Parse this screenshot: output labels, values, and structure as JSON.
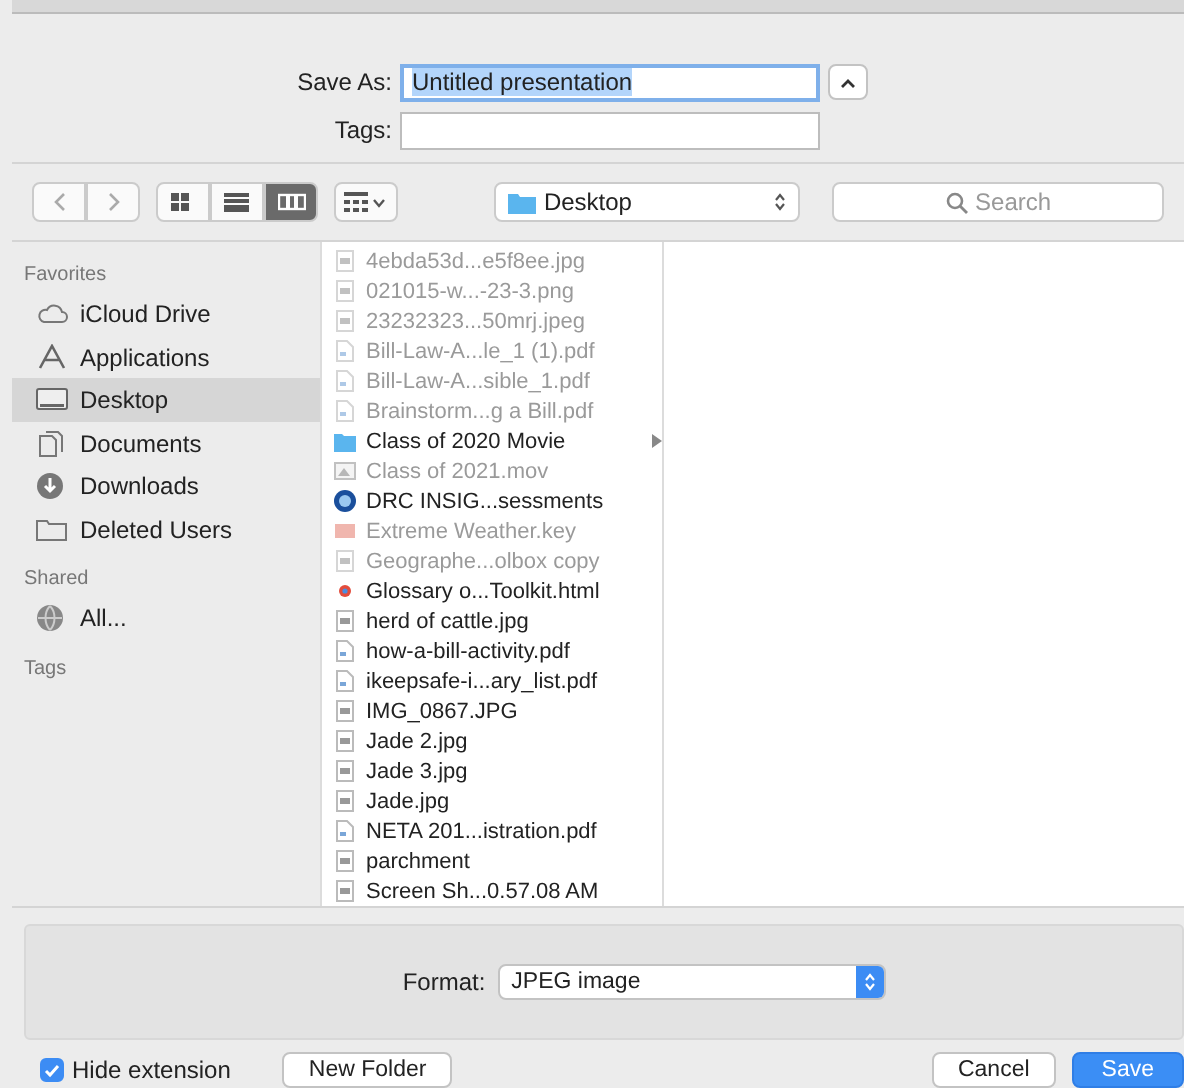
{
  "save_as": {
    "label": "Save As:",
    "value": "Untitled presentation",
    "text_selected": true
  },
  "tags": {
    "label": "Tags:"
  },
  "toolbar": {
    "views": [
      {
        "kind": "icons",
        "selected": false
      },
      {
        "kind": "list",
        "selected": false
      },
      {
        "kind": "columns",
        "selected": true
      }
    ],
    "location": "Desktop",
    "search": {
      "placeholder": "Search"
    }
  },
  "sidebar": [
    {
      "heading": "Favorites",
      "items": [
        {
          "label": "iCloud Drive",
          "kind": "cloud",
          "selected": false
        },
        {
          "label": "Applications",
          "kind": "apps",
          "selected": false
        },
        {
          "label": "Desktop",
          "kind": "desktop",
          "selected": true
        },
        {
          "label": "Documents",
          "kind": "documents",
          "selected": false
        },
        {
          "label": "Downloads",
          "kind": "downloads",
          "selected": false
        },
        {
          "label": "Deleted Users",
          "kind": "folder",
          "selected": false
        }
      ]
    },
    {
      "heading": "Shared",
      "items": [
        {
          "label": "All...",
          "kind": "network",
          "selected": false
        }
      ]
    },
    {
      "heading": "Tags"
    }
  ],
  "files": [
    {
      "name": "4ebda53d...e5f8ee.jpg",
      "kind": "image",
      "disabled": true
    },
    {
      "name": "021015-w...-23-3.png",
      "kind": "image",
      "disabled": true
    },
    {
      "name": "23232323...50mrj.jpeg",
      "kind": "image",
      "disabled": true
    },
    {
      "name": "Bill-Law-A...le_1 (1).pdf",
      "kind": "pdf",
      "disabled": true
    },
    {
      "name": "Bill-Law-A...sible_1.pdf",
      "kind": "pdf",
      "disabled": true
    },
    {
      "name": "Brainstorm...g a Bill.pdf",
      "kind": "pdf",
      "disabled": true
    },
    {
      "name": "Class of 2020 Movie",
      "kind": "folder",
      "disabled": false
    },
    {
      "name": "Class of 2021.mov",
      "kind": "movie",
      "disabled": true
    },
    {
      "name": "DRC INSIG...sessments",
      "kind": "app",
      "disabled": false
    },
    {
      "name": "Extreme Weather.key",
      "kind": "keynote",
      "disabled": true
    },
    {
      "name": "Geographe...olbox copy",
      "kind": "image",
      "disabled": true
    },
    {
      "name": "Glossary o...Toolkit.html",
      "kind": "html",
      "disabled": false
    },
    {
      "name": "herd of cattle.jpg",
      "kind": "image",
      "disabled": false
    },
    {
      "name": "how-a-bill-activity.pdf",
      "kind": "pdf",
      "disabled": false
    },
    {
      "name": "ikeepsafe-i...ary_list.pdf",
      "kind": "pdf",
      "disabled": false
    },
    {
      "name": "IMG_0867.JPG",
      "kind": "image",
      "disabled": false
    },
    {
      "name": "Jade 2.jpg",
      "kind": "image",
      "disabled": false
    },
    {
      "name": "Jade 3.jpg",
      "kind": "image",
      "disabled": false
    },
    {
      "name": "Jade.jpg",
      "kind": "image",
      "disabled": false
    },
    {
      "name": "NETA 201...istration.pdf",
      "kind": "pdf",
      "disabled": false
    },
    {
      "name": "parchment",
      "kind": "image",
      "disabled": false
    },
    {
      "name": "Screen Sh...0.57.08 AM",
      "kind": "image",
      "disabled": false
    }
  ],
  "format": {
    "label": "Format:",
    "value": "JPEG image"
  },
  "hide_extension": {
    "label": "Hide extension",
    "checked": true
  },
  "buttons": [
    {
      "label": "New Folder",
      "kind": "secondary"
    },
    {
      "label": "Cancel",
      "kind": "default"
    },
    {
      "label": "Save",
      "kind": "primary"
    }
  ]
}
